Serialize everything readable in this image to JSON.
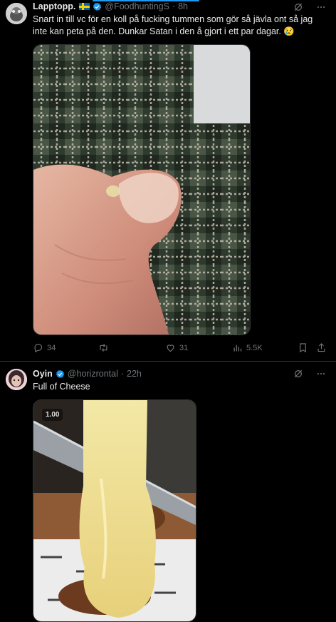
{
  "tweets": [
    {
      "author_name": "Lapptopp.",
      "handle": "@FoodhuntingS",
      "separator": "·",
      "time": "8h",
      "text": "Snart in till vc för en koll på fucking tummen som gör så jävla ont så jag inte kan peta på den. Dunkar Satan i den å gjort i ett par dagar. 😢",
      "stats": {
        "replies": "34",
        "retweets": "",
        "likes": "31",
        "views": "5.5K"
      }
    },
    {
      "author_name": "Oyin",
      "handle": "@horizrontal",
      "separator": "·",
      "time": "22h",
      "text": "Full of Cheese",
      "video_badge": "1.00"
    }
  ],
  "colors": {
    "accent": "#1d9bf0",
    "muted": "#71767b",
    "background": "#000000",
    "divider": "#2f3336"
  }
}
